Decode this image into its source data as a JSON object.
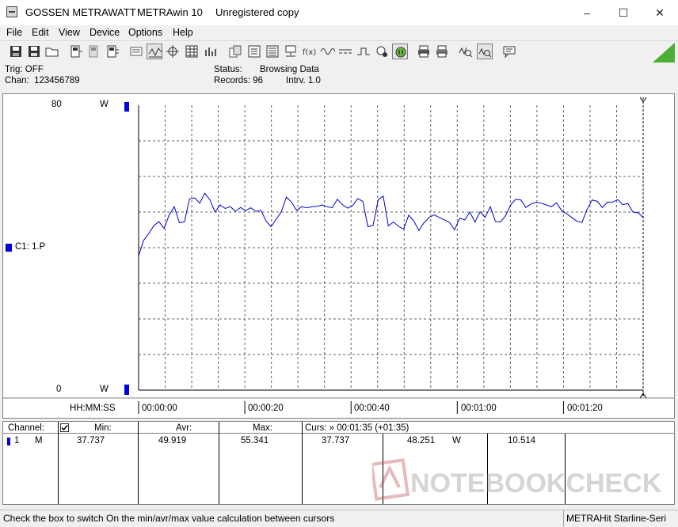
{
  "window": {
    "app_name": "GOSSEN METRAWATT",
    "program": "METRAwin 10",
    "license": "Unregistered copy",
    "minimize": "–",
    "maximize": "☐",
    "close": "✕"
  },
  "menu": [
    "File",
    "Edit",
    "View",
    "Device",
    "Options",
    "Help"
  ],
  "toolbar_icons": [
    "save-icon",
    "save-as-icon",
    "open-folder-icon",
    "device-read-icon",
    "device-send-icon",
    "device-connect-icon",
    "list-view-icon",
    "oscillograph-view-icon",
    "crosshair-icon",
    "table-view-icon",
    "bar-view-icon",
    "copy-icon",
    "export-icon",
    "stats-icon",
    "network-icon",
    "formula-icon",
    "waveform-icon",
    "dc-icon",
    "trigger-icon",
    "settings-icon",
    "pause-icon",
    "print-icon",
    "print-preview-icon",
    "zoom-cursor-icon",
    "zoom-fit-icon",
    "comment-icon"
  ],
  "status": {
    "trig": "Trig: OFF",
    "chan": "Chan:  123456789",
    "status_label": "Status:",
    "status_value": "Browsing Data",
    "records": "Records: 96",
    "interval": "Intrv. 1.0"
  },
  "plot": {
    "y_max": "80",
    "y_min": "0",
    "unit": "W",
    "channel_label": "C1: 1.P",
    "time_label": "HH:MM:SS",
    "time_ticks": [
      "00:00:00",
      "00:00:20",
      "00:00:40",
      "00:01:00",
      "00:01:20"
    ],
    "line_color": "#0000cc",
    "marker_color": "#0000e0"
  },
  "chart_data": {
    "type": "line",
    "xlabel": "HH:MM:SS",
    "ylabel": "W",
    "xlim": [
      0,
      96
    ],
    "ylim": [
      0,
      80
    ],
    "x_tick_labels": [
      "00:00:00",
      "00:00:20",
      "00:00:40",
      "00:01:00",
      "00:01:20"
    ],
    "series": [
      {
        "name": "C1: 1.P",
        "values": [
          37.7,
          42.1,
          44.0,
          46.2,
          47.3,
          45.4,
          49.2,
          51.5,
          47.0,
          47.3,
          53.7,
          54.0,
          52.5,
          55.3,
          53.4,
          50.0,
          52.0,
          51.0,
          51.5,
          50.2,
          51.3,
          50.4,
          51.2,
          50.2,
          50.5,
          47.5,
          45.9,
          48.0,
          50.1,
          54.2,
          52.8,
          50.5,
          51.5,
          51.2,
          51.5,
          51.6,
          52.0,
          51.5,
          51.2,
          53.6,
          52.1,
          51.1,
          51.8,
          53.8,
          53.0,
          45.9,
          46.2,
          53.4,
          54.5,
          46.1,
          47.2,
          46.0,
          45.2,
          49.1,
          47.5,
          44.8,
          47.0,
          48.5,
          49.2,
          48.5,
          47.8,
          47.1,
          45.0,
          48.3,
          47.8,
          50.0,
          47.2,
          50.1,
          48.5,
          51.5,
          47.4,
          47.2,
          49.0,
          52.0,
          53.6,
          53.4,
          51.3,
          52.3,
          52.7,
          52.5,
          52.0,
          51.5,
          52.6,
          50.4,
          49.5,
          48.5,
          47.4,
          47.1,
          50.8,
          53.4,
          53.0,
          51.3,
          52.8,
          52.8,
          53.5,
          52.1,
          52.4,
          50.0,
          49.8,
          48.5
        ]
      }
    ]
  },
  "table": {
    "headers": {
      "channel": "Channel:",
      "min": "Min:",
      "avr": "Avr:",
      "max": "Max:",
      "curs": "Curs: » 00:01:35 (+01:35)"
    },
    "row": {
      "num": "1",
      "mode": "M",
      "min": "37.737",
      "avr": "49.919",
      "max": "55.341",
      "curs1": "37.737",
      "curs2": "48.251",
      "unit": "W",
      "curs3": "10.514"
    }
  },
  "statusbar": {
    "hint": "Check the box to switch On the min/avr/max value calculation between cursors",
    "device": "METRAHit Starline-Seri"
  },
  "watermark": "NOTEBOOKCHECK"
}
